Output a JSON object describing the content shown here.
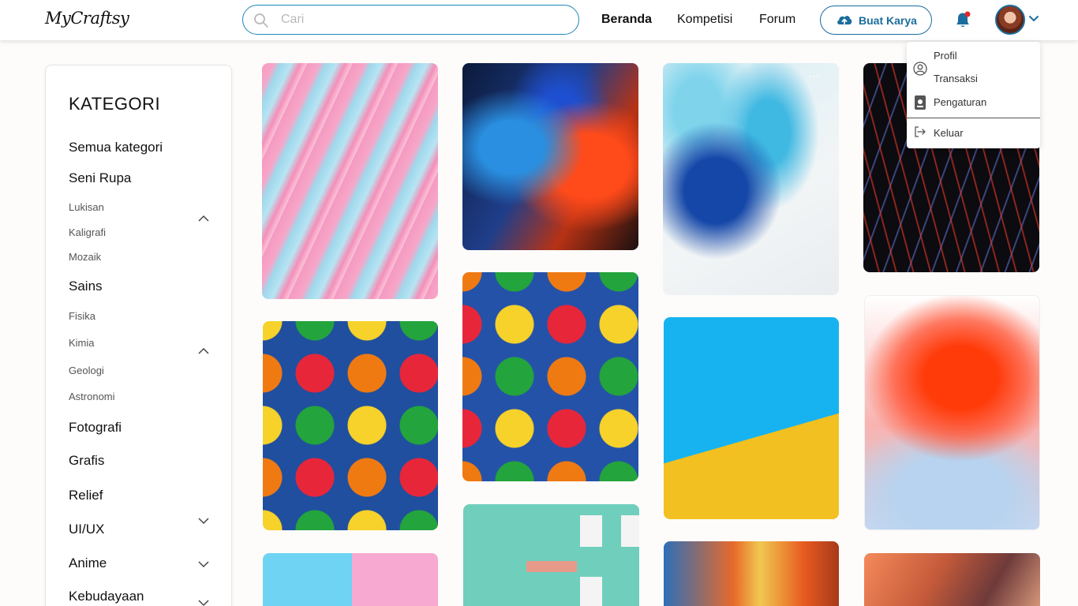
{
  "header": {
    "logo": "MyCraftsy",
    "search_placeholder": "Cari",
    "nav": [
      {
        "label": "Beranda",
        "active": true
      },
      {
        "label": "Kompetisi",
        "active": false
      },
      {
        "label": "Forum",
        "active": false
      }
    ],
    "create_button": "Buat Karya",
    "accent_color": "#1a6d9c",
    "notification_icon": "bell-icon"
  },
  "profile_menu": {
    "items": [
      {
        "label": "Profil",
        "icon": "user-circle-icon"
      },
      {
        "label": "Transaksi",
        "icon": "receipt-icon"
      },
      {
        "label": "Pengaturan",
        "icon": "settings-icon"
      },
      {
        "label": "Keluar",
        "icon": "logout-icon"
      }
    ]
  },
  "sidebar": {
    "title": "KATEGORI",
    "all": "Semua kategori",
    "categories": [
      {
        "label": "Seni Rupa",
        "subs": [
          "Lukisan",
          "Kaligrafi",
          "Mozaik"
        ]
      },
      {
        "label": "Sains",
        "subs": [
          "Fisika",
          "Kimia",
          "Geologi",
          "Astronomi"
        ]
      },
      {
        "label": "Fotografi"
      },
      {
        "label": "Grafis"
      },
      {
        "label": "Relief"
      },
      {
        "label": "UI/UX"
      },
      {
        "label": "Anime"
      },
      {
        "label": "Kebudayaan"
      }
    ]
  },
  "gallery": {
    "items": [
      {
        "name": "pink-blue-fluid-art"
      },
      {
        "name": "colorful-umbrellas"
      },
      {
        "name": "pastel-donuts"
      },
      {
        "name": "ink-smoke-red-blue"
      },
      {
        "name": "umbrellas-sky"
      },
      {
        "name": "mint-building"
      },
      {
        "name": "blue-white-splash"
      },
      {
        "name": "pool-ladder-yellow"
      },
      {
        "name": "colorful-facade"
      },
      {
        "name": "neon-light-trails"
      },
      {
        "name": "red-gradient-blur"
      },
      {
        "name": "sunset-clouds"
      }
    ]
  }
}
